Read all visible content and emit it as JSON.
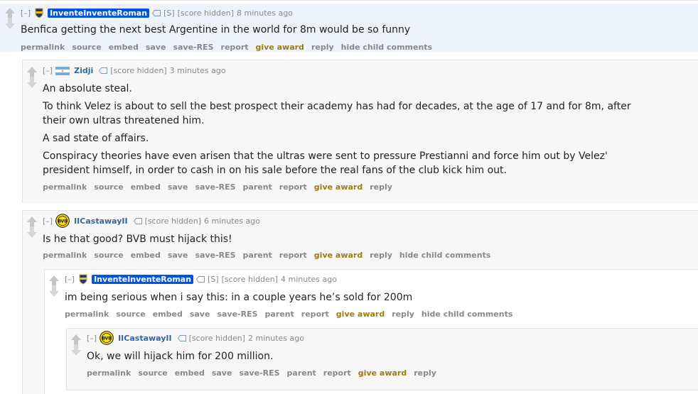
{
  "comments": {
    "c1": {
      "collapse": "[–]",
      "author": "InventeInventeRoman",
      "tag": "[S]",
      "score": "[score hidden]",
      "time": "8 minutes ago",
      "body": [
        "Benfica getting the next best Argentine in the world for 8m would be so funny"
      ],
      "buttons": [
        "permalink",
        "source",
        "embed",
        "save",
        "save-RES",
        "report",
        "give award",
        "reply",
        "hide child comments"
      ]
    },
    "c2": {
      "collapse": "[–]",
      "author": "Zidji",
      "score": "[score hidden]",
      "time": "3 minutes ago",
      "body": [
        "An absolute steal.",
        "To think Velez is about to sell the best prospect their academy has had for decades, at the age of 17 and for 8m, after their own ultras threatened him.",
        "A sad state of affairs.",
        "Conspiracy theories have even arisen that the ultras were sent to pressure Prestianni and force him out by Velez' president himself, in order to cash in on his sale before the real fans of the club kick him out."
      ],
      "buttons": [
        "permalink",
        "source",
        "embed",
        "save",
        "save-RES",
        "parent",
        "report",
        "give award",
        "reply"
      ]
    },
    "c3": {
      "collapse": "[–]",
      "author": "IICastawayII",
      "score": "[score hidden]",
      "time": "6 minutes ago",
      "body": [
        "Is he that good? BVB must hijack this!"
      ],
      "buttons": [
        "permalink",
        "source",
        "embed",
        "save",
        "save-RES",
        "parent",
        "report",
        "give award",
        "reply",
        "hide child comments"
      ]
    },
    "c4": {
      "collapse": "[–]",
      "author": "InventeInventeRoman",
      "tag": "[S]",
      "score": "[score hidden]",
      "time": "4 minutes ago",
      "body": [
        "im being serious when i say this: in a couple years he’s sold for 200m"
      ],
      "buttons": [
        "permalink",
        "source",
        "embed",
        "save",
        "save-RES",
        "parent",
        "report",
        "give award",
        "reply",
        "hide child comments"
      ]
    },
    "c5": {
      "collapse": "[–]",
      "author": "IICastawayII",
      "score": "[score hidden]",
      "time": "2 minutes ago",
      "body": [
        "Ok, we will hijack him for 200 million."
      ],
      "buttons": [
        "permalink",
        "source",
        "embed",
        "save",
        "save-RES",
        "parent",
        "report",
        "give award",
        "reply"
      ]
    }
  },
  "flairs": {
    "boca": "boca-juniors-crest-icon",
    "argentina": "argentina-flag-icon",
    "bvb": "bvb-crest-icon",
    "tag": "tag-icon"
  },
  "colors": {
    "op_badge": "#0055df",
    "author": "#336699",
    "award": "#9a7d0a",
    "highlight": "#eef3fb"
  }
}
